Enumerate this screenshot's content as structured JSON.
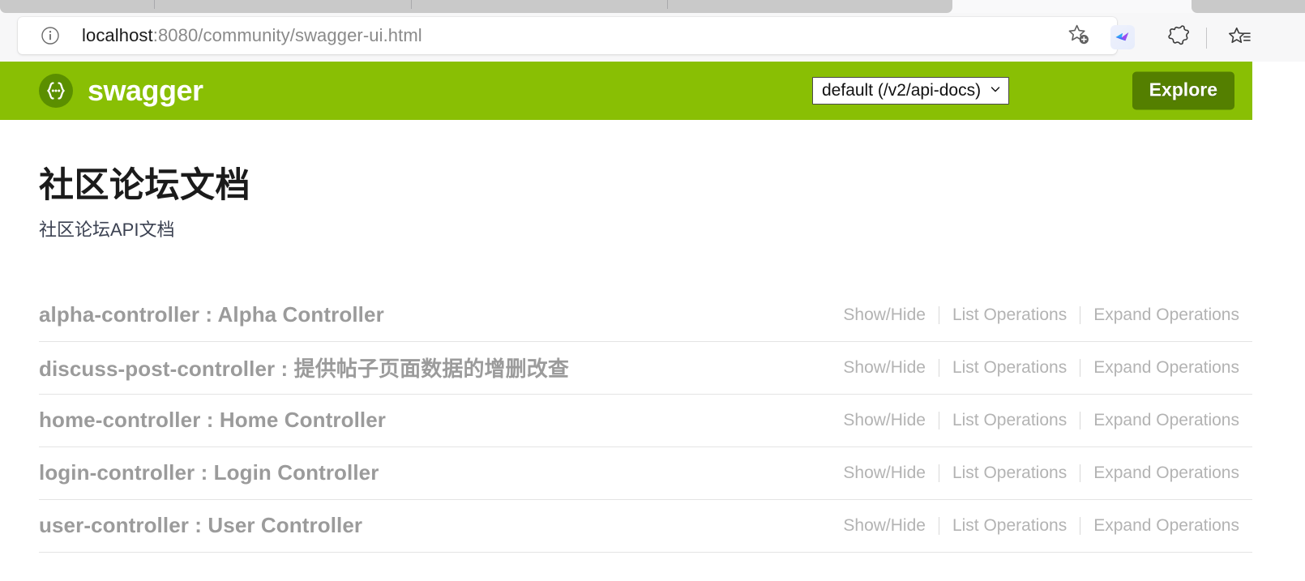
{
  "browser": {
    "url_host": "localhost",
    "url_rest": ":8080/community/swagger-ui.html",
    "icons": {
      "site_info": "info-icon",
      "add_favorite": "star-plus-icon",
      "extension_bird": "bird-extension-icon",
      "extensions": "puzzle-extensions-icon",
      "collections": "collections-star-icon"
    }
  },
  "swagger_header": {
    "brand": "swagger",
    "logo_glyph": "{...}",
    "spec_select_value": "default (/v2/api-docs)",
    "spec_select_chevron": "⌄",
    "explore_label": "Explore",
    "bar_color": "#89bf04",
    "explore_color": "#547f00",
    "logo_circle_color": "#5b8f00"
  },
  "info": {
    "title": "社区论坛文档",
    "subtitle": "社区论坛API文档"
  },
  "operations_labels": {
    "show_hide": "Show/Hide",
    "list_operations": "List Operations",
    "expand_operations": "Expand Operations"
  },
  "resources": [
    {
      "name": "alpha-controller : Alpha Controller"
    },
    {
      "name": "discuss-post-controller : 提供帖子页面数据的增删改查"
    },
    {
      "name": "home-controller : Home Controller"
    },
    {
      "name": "login-controller : Login Controller"
    },
    {
      "name": "user-controller : User Controller"
    }
  ]
}
